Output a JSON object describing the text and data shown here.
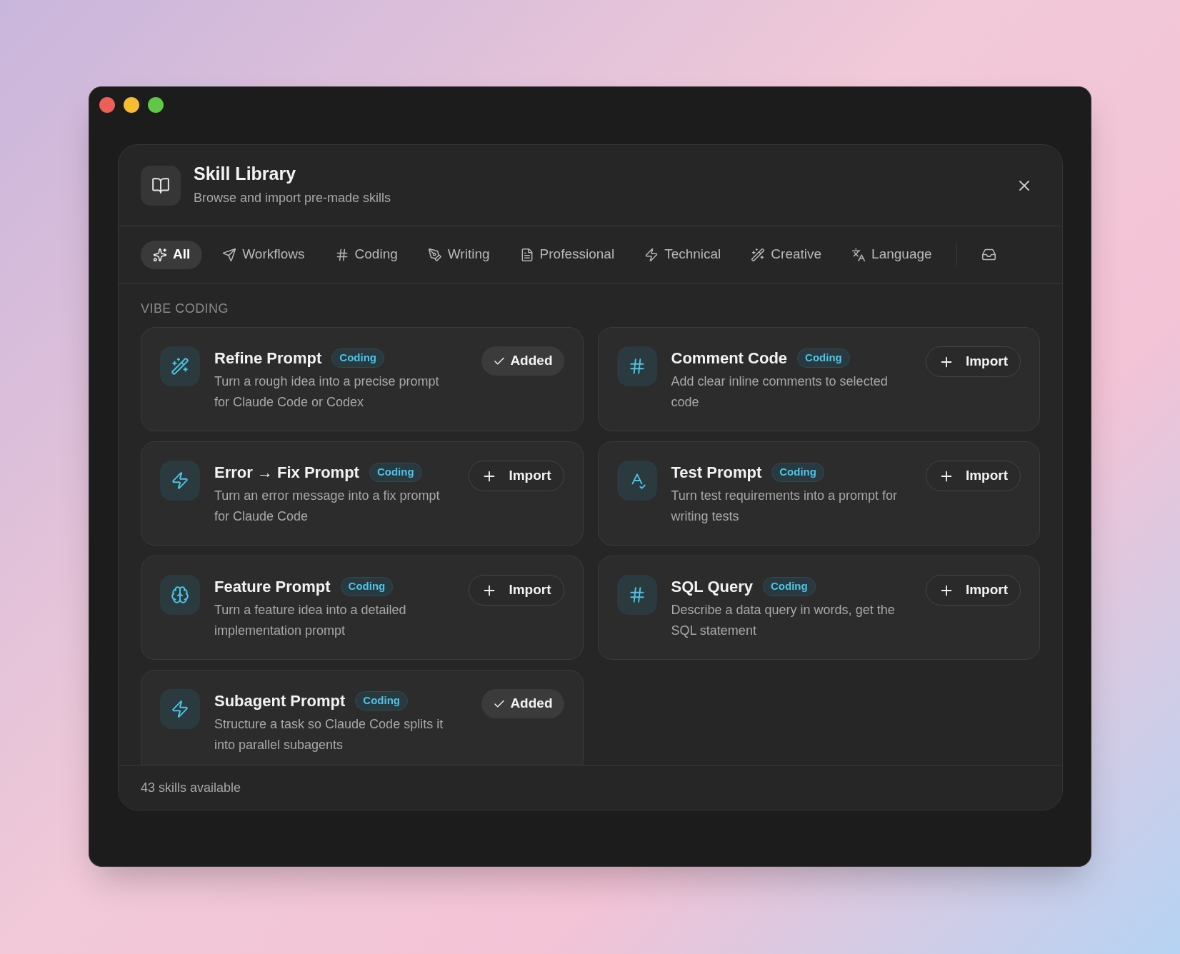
{
  "dialog": {
    "title": "Skill Library",
    "subtitle": "Browse and import pre-made skills"
  },
  "tabs": [
    {
      "label": "All",
      "selected": true
    },
    {
      "label": "Workflows",
      "selected": false
    },
    {
      "label": "Coding",
      "selected": false
    },
    {
      "label": "Writing",
      "selected": false
    },
    {
      "label": "Professional",
      "selected": false
    },
    {
      "label": "Technical",
      "selected": false
    },
    {
      "label": "Creative",
      "selected": false
    },
    {
      "label": "Language",
      "selected": false
    }
  ],
  "section": {
    "heading": "VIBE CODING"
  },
  "skills": [
    {
      "name": "Refine Prompt",
      "tag": "Coding",
      "description": "Turn a rough idea into a precise prompt for Claude Code or Codex",
      "added": true,
      "action": "Added"
    },
    {
      "name": "Comment Code",
      "tag": "Coding",
      "description": "Add clear inline comments to selected code",
      "added": false,
      "action": "Import"
    },
    {
      "name": "Error → Fix Prompt",
      "tag": "Coding",
      "description": "Turn an error message into a fix prompt for Claude Code",
      "added": false,
      "action": "Import"
    },
    {
      "name": "Test Prompt",
      "tag": "Coding",
      "description": "Turn test requirements into a prompt for writing tests",
      "added": false,
      "action": "Import"
    },
    {
      "name": "Feature Prompt",
      "tag": "Coding",
      "description": "Turn a feature idea into a detailed implementation prompt",
      "added": false,
      "action": "Import"
    },
    {
      "name": "SQL Query",
      "tag": "Coding",
      "description": "Describe a data query in words, get the SQL statement",
      "added": false,
      "action": "Import"
    },
    {
      "name": "Subagent Prompt",
      "tag": "Coding",
      "description": "Structure a task so Claude Code splits it into parallel subagents",
      "added": true,
      "action": "Added"
    }
  ],
  "footer": {
    "count": "43 skills available"
  }
}
